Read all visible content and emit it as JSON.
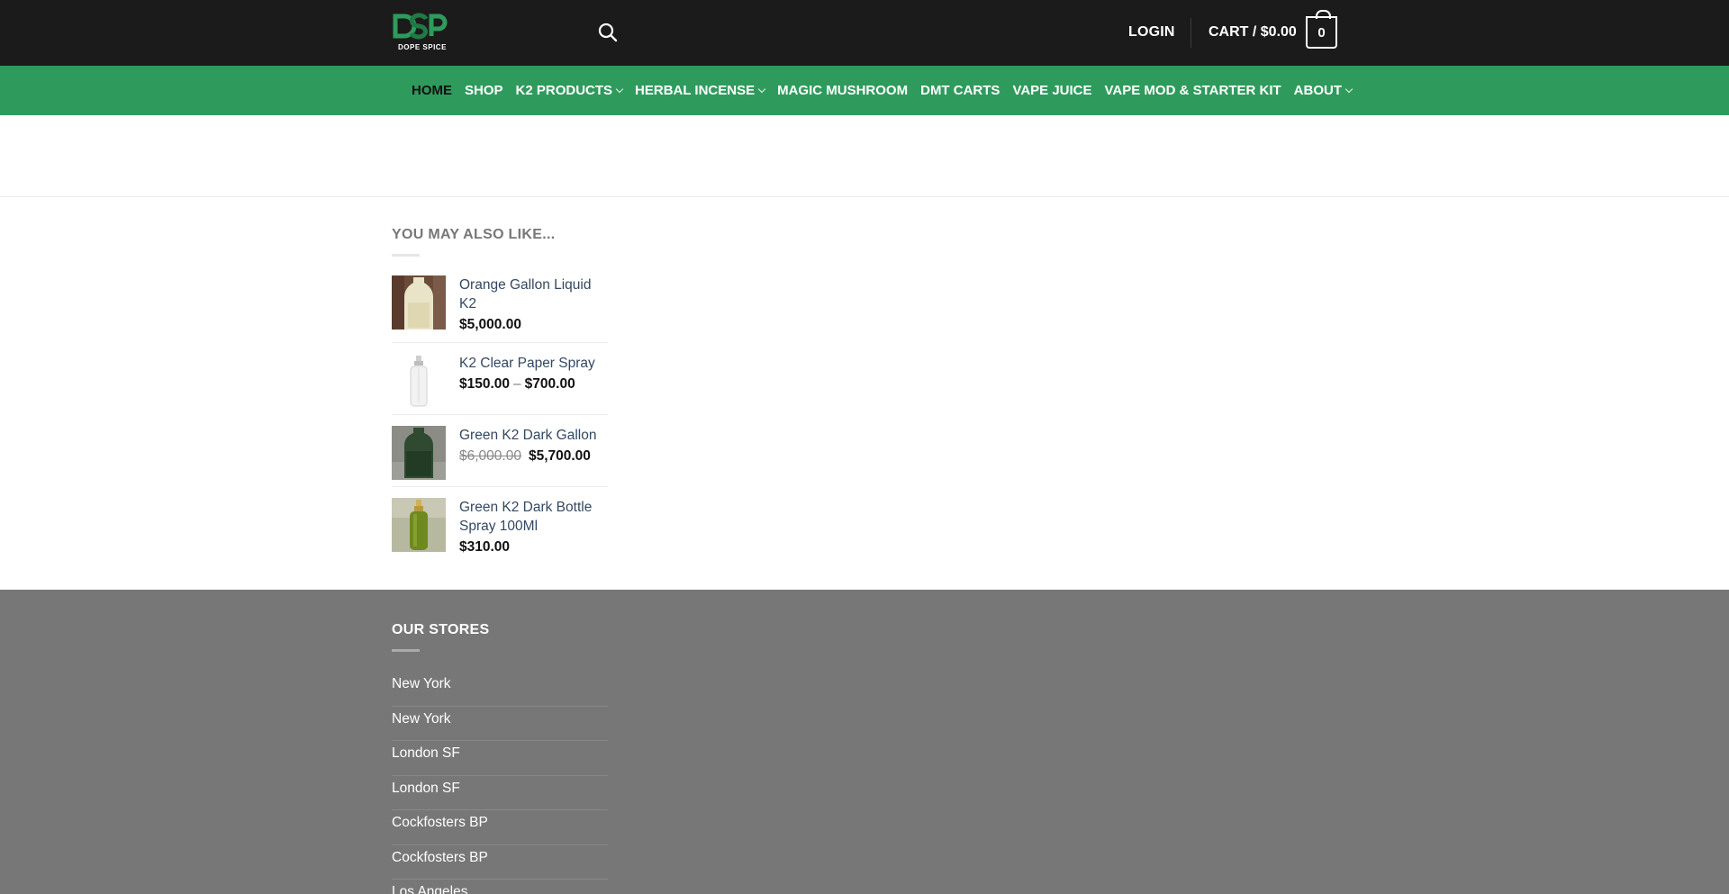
{
  "header": {
    "logo_text": "DOPE SPICE",
    "login_label": "LOGIN",
    "cart_label": "CART / $0.00",
    "cart_count": "0"
  },
  "nav": {
    "items": [
      {
        "label": "HOME",
        "active": true,
        "dropdown": false
      },
      {
        "label": "SHOP",
        "dropdown": false
      },
      {
        "label": "K2 PRODUCTS",
        "dropdown": true
      },
      {
        "label": "HERBAL INCENSE",
        "dropdown": true
      },
      {
        "label": "MAGIC MUSHROOM",
        "dropdown": false
      },
      {
        "label": "DMT CARTS",
        "dropdown": false
      },
      {
        "label": "VAPE JUICE",
        "dropdown": false
      },
      {
        "label": "VAPE MOD & STARTER KIT",
        "dropdown": false
      },
      {
        "label": "ABOUT",
        "dropdown": true
      }
    ]
  },
  "related": {
    "title": "YOU MAY ALSO LIKE...",
    "products": [
      {
        "name": "Orange Gallon Liquid K2",
        "price": "$5,000.00"
      },
      {
        "name": "K2 Clear Paper Spray",
        "price_min": "$150.00",
        "price_sep": "–",
        "price_max": "$700.00"
      },
      {
        "name": "Green K2 Dark Gallon",
        "old_price": "$6,000.00",
        "price": "$5,700.00"
      },
      {
        "name": "Green K2 Dark Bottle Spray 100Ml",
        "price": "$310.00"
      }
    ]
  },
  "footer": {
    "stores_title": "OUR STORES",
    "stores": [
      "New York",
      "New York",
      "London SF",
      "London SF",
      "Cockfosters BP",
      "Cockfosters BP",
      "Los Angeles"
    ]
  },
  "colors": {
    "topbar": "#1b1b1b",
    "nav": "#2e9b5c",
    "footer": "#777777",
    "link": "#334862"
  }
}
